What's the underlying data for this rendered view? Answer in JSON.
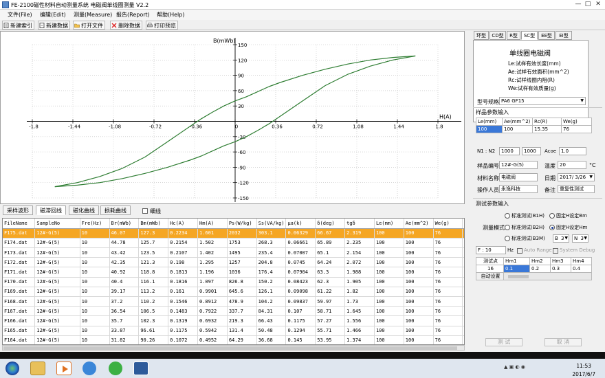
{
  "window": {
    "title": "FE-2100磁性材料自动测量系统 电磁阀单线圈测量 V2.2",
    "buttons": [
      "—",
      "□",
      "✕"
    ]
  },
  "menu": [
    "文件(File)",
    "编辑(Edit)",
    "测量(Measure)",
    "报告(Report)",
    "帮助(Help)"
  ],
  "toolbar": [
    {
      "label": "新建索引",
      "icon": "new-index-icon"
    },
    {
      "label": "新建数据",
      "icon": "new-data-icon"
    },
    {
      "label": "打开文件",
      "icon": "open-folder-icon"
    },
    {
      "label": "删除数据",
      "icon": "delete-icon"
    },
    {
      "label": "打印预览",
      "icon": "print-preview-icon"
    }
  ],
  "chart_data": {
    "type": "line",
    "title": "",
    "xlabel": "H(A)",
    "ylabel": "B(mWb)",
    "xlim": [
      -1.8,
      1.8
    ],
    "ylim": [
      -150,
      150
    ],
    "xticks": [
      -1.8,
      -1.44,
      -1.08,
      -0.72,
      -0.36,
      0,
      0.36,
      0.72,
      1.08,
      1.44,
      1.8
    ],
    "xtick_labels": [
      "-1.8",
      "-1.44",
      "-1.08",
      "-0.72",
      "-0.36",
      "0",
      "0.36",
      "0.72",
      "1.08",
      "1.44",
      "1.8"
    ],
    "yticks": [
      150,
      120,
      90,
      60,
      30,
      0,
      -30,
      -60,
      -90,
      -120,
      -150
    ],
    "ytick_labels": [
      "150",
      "120",
      "90",
      "60",
      "30",
      "0",
      "-30",
      "-60",
      "-90",
      "-120",
      "-150"
    ],
    "grid": true,
    "line_color": "#2e7d32",
    "series": [
      {
        "x": [
          1.6,
          1.4,
          1.2,
          1.0,
          0.8,
          0.6,
          0.4,
          0.3,
          0.2,
          0.1,
          0.0,
          -0.1,
          -0.2,
          -0.3,
          -0.4,
          -0.6,
          -0.8,
          -1.0,
          -1.2,
          -1.4,
          -1.6
        ],
        "y": [
          128,
          125,
          120,
          112,
          102,
          90,
          76,
          68,
          58,
          48,
          40,
          30,
          18,
          5,
          -10,
          -40,
          -70,
          -92,
          -108,
          -120,
          -128
        ]
      },
      {
        "x": [
          -1.6,
          -1.4,
          -1.2,
          -1.0,
          -0.8,
          -0.6,
          -0.4,
          -0.3,
          -0.2,
          -0.1,
          0.0,
          0.1,
          0.2,
          0.3,
          0.4,
          0.6,
          0.8,
          1.0,
          1.2,
          1.4,
          1.6
        ],
        "y": [
          -128,
          -125,
          -120,
          -112,
          -102,
          -90,
          -76,
          -68,
          -58,
          -48,
          -40,
          -30,
          -18,
          -5,
          10,
          40,
          70,
          92,
          108,
          120,
          128
        ]
      }
    ]
  },
  "chart_tabs": {
    "items": [
      "采样波形",
      "磁滞回线",
      "磁化曲线",
      "损耗曲线"
    ],
    "active": 1,
    "checkbox_label": "细线"
  },
  "table": {
    "columns": [
      "FileName",
      "SampleNo",
      "Fre(Hz)",
      "Br(mWb)",
      "Bm(mWb)",
      "Hc(A)",
      "Hm(A)",
      "Ps(W/kg)",
      "Ss(VA/kg)",
      "μa(k)",
      "δ(deg)",
      "tgδ",
      "Le(mm)",
      "Ae(mm^2)",
      "We(g)",
      "Da"
    ],
    "rows": [
      [
        "F175.dat",
        "12#-G(5)",
        "10",
        "46.07",
        "127.3",
        "0.2234",
        "1.601",
        "2032",
        "303.1",
        "0.06329",
        "66.67",
        "2.319",
        "100",
        "100",
        "76",
        "201"
      ],
      [
        "F174.dat",
        "12#-G(5)",
        "10",
        "44.78",
        "125.7",
        "0.2154",
        "1.502",
        "1753",
        "268.3",
        "0.06661",
        "65.89",
        "2.235",
        "100",
        "100",
        "76",
        "201"
      ],
      [
        "F173.dat",
        "12#-G(5)",
        "10",
        "43.42",
        "123.5",
        "0.2107",
        "1.402",
        "1495",
        "235.4",
        "0.07007",
        "65.1",
        "2.154",
        "100",
        "100",
        "76",
        "201"
      ],
      [
        "F172.dat",
        "12#-G(5)",
        "10",
        "42.35",
        "121.3",
        "0.198",
        "1.295",
        "1257",
        "204.8",
        "0.0745",
        "64.24",
        "2.072",
        "100",
        "100",
        "76",
        "201"
      ],
      [
        "F171.dat",
        "12#-G(5)",
        "10",
        "40.92",
        "118.8",
        "0.1813",
        "1.196",
        "1036",
        "176.4",
        "0.07904",
        "63.3",
        "1.988",
        "100",
        "100",
        "76",
        "201"
      ],
      [
        "F170.dat",
        "12#-G(5)",
        "10",
        "40.4",
        "116.1",
        "0.1816",
        "1.097",
        "826.8",
        "150.2",
        "0.08423",
        "62.3",
        "1.905",
        "100",
        "100",
        "76",
        "201"
      ],
      [
        "F169.dat",
        "12#-G(5)",
        "10",
        "39.17",
        "113.2",
        "0.161",
        "0.9901",
        "645.6",
        "126.1",
        "0.09098",
        "61.22",
        "1.82",
        "100",
        "100",
        "76",
        "201"
      ],
      [
        "F168.dat",
        "12#-G(5)",
        "10",
        "37.2",
        "110.2",
        "0.1546",
        "0.8912",
        "478.9",
        "104.2",
        "0.09837",
        "59.97",
        "1.73",
        "100",
        "100",
        "76",
        "201"
      ],
      [
        "F167.dat",
        "12#-G(5)",
        "10",
        "36.54",
        "106.5",
        "0.1483",
        "0.7922",
        "337.7",
        "84.31",
        "0.107",
        "58.71",
        "1.645",
        "100",
        "100",
        "76",
        "201"
      ],
      [
        "F166.dat",
        "12#-G(5)",
        "10",
        "35.7",
        "102.3",
        "0.1319",
        "0.6932",
        "219.3",
        "66.43",
        "0.1175",
        "57.27",
        "1.556",
        "100",
        "100",
        "76",
        "201"
      ],
      [
        "F165.dat",
        "12#-G(5)",
        "10",
        "33.87",
        "96.61",
        "0.1175",
        "0.5942",
        "131.4",
        "50.48",
        "0.1294",
        "55.71",
        "1.466",
        "100",
        "100",
        "76",
        "201"
      ],
      [
        "F164.dat",
        "12#-G(5)",
        "10",
        "31.82",
        "90.26",
        "0.1072",
        "0.4952",
        "64.29",
        "36.68",
        "0.145",
        "53.95",
        "1.374",
        "100",
        "100",
        "76",
        "201"
      ]
    ],
    "selected_row": 0
  },
  "right": {
    "tabs": [
      "环型",
      "CD型",
      "R型",
      "SC型",
      "EE型",
      "EI型"
    ],
    "active_tab": 3,
    "desc": {
      "title": "单线圈电磁阀",
      "lines": [
        "Le:试样有效长度(mm)",
        "Ae:试样有效面积(mm^2)",
        "Rc:试样线圈内阻(R)",
        "We:试样有效质量(g)"
      ]
    },
    "model_label": "型号规格",
    "model_value": "PA6 GF15",
    "sample_group": "样品参数输入",
    "param_headers": [
      "Le(mm)",
      "Ae(mm^2)",
      "Rc(R)",
      "We(g)"
    ],
    "param_values": [
      "100",
      "100",
      "15.35",
      "76"
    ],
    "n_label": "N1 : N2",
    "n1": "1000",
    "n2": "1000",
    "acoe_label": "Acoe",
    "acoe_value": "1.0",
    "sample_no_label": "样品编号",
    "sample_no_value": "12#-G(5)",
    "temp_label": "温度",
    "temp_value": "20",
    "temp_unit": "°C",
    "material_label": "材料名称",
    "material_value": "电磁阀",
    "date_label": "日期",
    "date_value": "2017/ 3/26",
    "operator_label": "操作人员",
    "operator_value": "永逸科技",
    "note_label": "备注",
    "note_value": "重复性测试",
    "test_group": "测试参数输入",
    "radio_std_bh": "标准测试(B1H)",
    "radio_fixed_bm": "固定H设定Bm",
    "mode_label": "测量模式",
    "radio_std_b2h": "标准测试(B2H)",
    "radio_fixed_hm": "固定H设定Hm",
    "b_select": "B",
    "b_value": "3",
    "n_select": "N",
    "n_value": "3",
    "radio_std_b3m": "标准测试(B3M)",
    "f_label": "F : 10",
    "hz_label": "Hz",
    "auto_range": "Auto Range",
    "system_debug": "System Debug",
    "pt_headers": [
      "测试点",
      "Hm1",
      "Hm2",
      "Hm3",
      "Hm4"
    ],
    "pt_count": "16",
    "pt_values": [
      "0.1",
      "0.2",
      "0.3",
      "0.4"
    ],
    "auto_save": "自动设置",
    "btn_test": "测 试",
    "btn_cancel": "取 消"
  },
  "taskbar": {
    "time": "11:53",
    "date": "2017/6/7"
  }
}
